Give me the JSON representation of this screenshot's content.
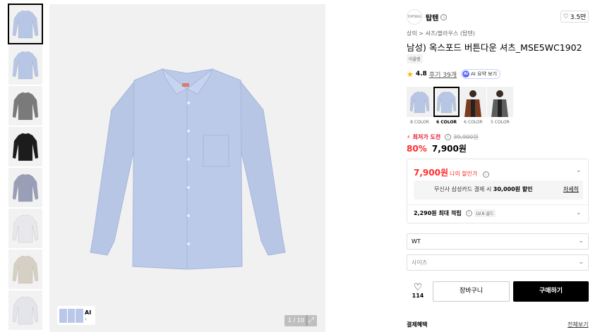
{
  "thumbnails": [
    {
      "label": "thumb-1",
      "color": "#b8c6e6"
    },
    {
      "label": "thumb-2",
      "color": "#b8c6e6"
    },
    {
      "label": "thumb-3",
      "color": "#7a7a7a"
    },
    {
      "label": "thumb-4",
      "color": "#1c1c1c"
    },
    {
      "label": "thumb-5",
      "color": "#9a9fb8"
    },
    {
      "label": "thumb-6",
      "color": "#e8e8ec"
    },
    {
      "label": "thumb-7",
      "color": "#d6d0c4"
    },
    {
      "label": "thumb-8",
      "color": "#e3e5ea"
    }
  ],
  "gallery": {
    "ai_label": "AI",
    "page_indicator": "1 / 10"
  },
  "brand": {
    "logo_text": "TOPTEN10",
    "name": "탑텐",
    "likes": "3.5만"
  },
  "breadcrumb": {
    "level1": "상의",
    "separator": ">",
    "level2": "셔츠/블라우스 (탑텐)"
  },
  "product": {
    "title": "남성) 옥스포드 버튼다운 셔츠_MSE5WC1902",
    "tag": "아울렛",
    "rating": "4.8",
    "reviews": "후기 39개",
    "ai_summary": "AI 요약 보기",
    "ai_badge": "AI"
  },
  "color_options": [
    {
      "label": "8 COLOR",
      "active": false
    },
    {
      "label": "6 COLOR",
      "active": true
    },
    {
      "label": "6 COLOR",
      "active": false
    },
    {
      "label": "5 COLOR",
      "active": false
    }
  ],
  "pricing": {
    "lowest_label": "최저가 도전",
    "original_price": "39,900원",
    "discount": "80%",
    "price": "7,900원",
    "my_price": "7,900원",
    "my_price_label": "나의 할인가",
    "card_promo_prefix": "무신사 삼성카드 결제 시",
    "card_promo_amount": "30,000원 할인",
    "card_promo_more": "자세히",
    "points": "2,290원 최대 적립",
    "level_badge": "LV.6 골드"
  },
  "options": {
    "color_value": "WT",
    "size_placeholder": "사이즈"
  },
  "actions": {
    "wish_count": "114",
    "cart_label": "장바구니",
    "buy_label": "구매하기"
  },
  "footer": {
    "benefit_label": "결제혜택",
    "benefit_more": "전체보기"
  },
  "colors": {
    "accent_red": "#ff2b2b",
    "star": "#ffb000",
    "shirt_blue": "#b8c6e6"
  }
}
